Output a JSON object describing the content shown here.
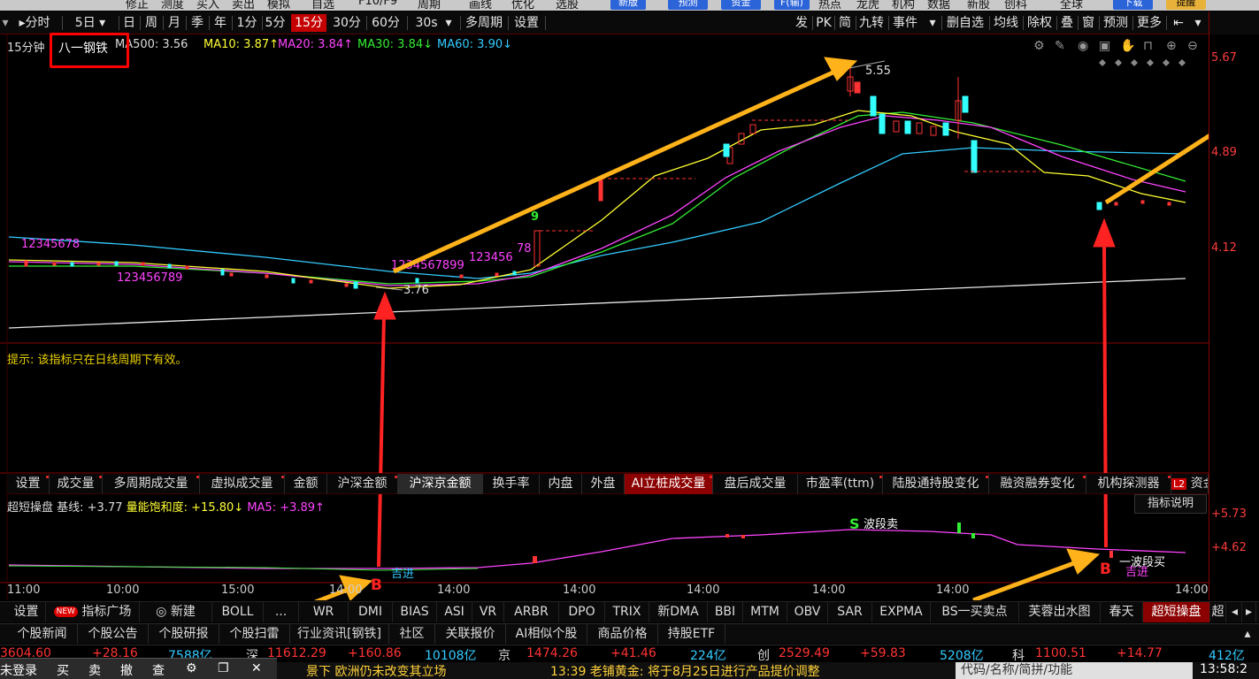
{
  "top_strip": {
    "items": [
      "修正",
      "测度",
      "买入",
      "卖出",
      "模拟",
      "自选",
      "F10/F9",
      "周期",
      "画线",
      "优化",
      "选股",
      "热点",
      "龙虎",
      "机构",
      "数据",
      "新股",
      "创科",
      "全球"
    ],
    "buttons": [
      "新版",
      "预测",
      "资金",
      "F(输)",
      "下载",
      "提醒"
    ]
  },
  "period_bar": {
    "items": [
      "分时",
      "5日",
      "日",
      "周",
      "月",
      "季",
      "年",
      "1分",
      "5分",
      "15分",
      "30分",
      "60分",
      "30s",
      "多周期",
      "设置"
    ],
    "active": "15分",
    "right": [
      "发",
      "PK",
      "简",
      "九转",
      "事件",
      "删自选",
      "均线",
      "除权",
      "叠",
      "窗",
      "预测",
      "更多"
    ]
  },
  "ma_line": {
    "period": "15分钟",
    "stock": "八一钢铁",
    "ma5": "MA500: 3.56",
    "ma10": "MA10: 3.87↑",
    "ma20": "MA20: 3.84↑",
    "ma30": "MA30: 3.84↓",
    "ma60": "MA60: 3.90↓",
    "colors": {
      "ma10": "#ffff00",
      "ma20": "#ff44ff",
      "ma30": "#33ee33",
      "ma60": "#33ccff"
    }
  },
  "main_chart": {
    "price_high": "5.55",
    "price_low": "3.76",
    "td_labels": [
      "123456789",
      "12345678",
      "1234567899",
      "123456",
      "78",
      "9"
    ]
  },
  "price_axis": [
    "5.67",
    "4.89",
    "4.12"
  ],
  "hint": "提示: 该指标只在日线周期下有效。",
  "tabs1": [
    "设置",
    "成交量",
    "多周期成交量",
    "虚拟成交量",
    "金额",
    "沪深金额",
    "沪深京金额",
    "换手率",
    "内盘",
    "外盘",
    "AI立桩成交量",
    "盘后成交量",
    "市盈率(ttm)",
    "陆股通持股变化",
    "融资融券变化",
    "机构探测器",
    "资金抄底"
  ],
  "tabs1_selected": "沪深京金额",
  "tabs1_ai": "AI立桩成交量",
  "tabs1_l2": "L2",
  "indicator": {
    "name": "超短操盘",
    "base": "基线: +3.77",
    "energy": "量能饱和度: +15.80↓",
    "ma5": "MA5: +3.89↑",
    "help": "指标说明",
    "axis": [
      "+5.73",
      "+4.62"
    ],
    "sell_label": "波段卖",
    "buy_label": "一波段买",
    "buy_label2": "吉进",
    "s_mark": "S",
    "b_mark": "B"
  },
  "time_axis": [
    "11:00",
    "10:00",
    "15:00",
    "14:00",
    "14:00",
    "14:00",
    "14:00",
    "14:00",
    "14:00",
    "14:00"
  ],
  "tabs2": [
    "设置",
    "NEW",
    "指标广场",
    "新建",
    "BOLL",
    "...",
    "WR",
    "DMI",
    "BIAS",
    "ASI",
    "VR",
    "ARBR",
    "DPO",
    "TRIX",
    "新DMA",
    "BBI",
    "MTM",
    "OBV",
    "SAR",
    "EXPMA",
    "BS一买卖点",
    "芙蓉出水图",
    "春天",
    "超短操盘",
    "超"
  ],
  "tabs2_highlight": "超短操盘",
  "tabs3": [
    "个股新闻",
    "个股公告",
    "个股研报",
    "个股扫雷",
    "行业资讯[钢铁]",
    "社区",
    "关联报价",
    "AI相似个股",
    "商品价格",
    "持股ETF"
  ],
  "index_bar": {
    "items": [
      {
        "label": "",
        "value": "3604.60",
        "change": "+28.16",
        "amount": "7588亿"
      },
      {
        "label": "深",
        "value": "11612.29",
        "change": "+160.86",
        "amount": "10108亿"
      },
      {
        "label": "京",
        "value": "1474.26",
        "change": "+41.46",
        "amount": "224亿"
      },
      {
        "label": "创",
        "value": "2529.49",
        "change": "+59.83",
        "amount": "5208亿"
      },
      {
        "label": "科",
        "value": "1100.51",
        "change": "+14.77",
        "amount": "412亿"
      }
    ]
  },
  "status_bar": {
    "news1": "景下 欧洲仍未改变其立场",
    "news2": "13:39 老铺黄金: 将于8月25日进行产品提价调整",
    "search_placeholder": "代码/名称/简拼/功能",
    "clock": "13:58:2"
  },
  "taskbar": {
    "items": [
      "未登录",
      "买",
      "卖",
      "撤",
      "查"
    ]
  }
}
